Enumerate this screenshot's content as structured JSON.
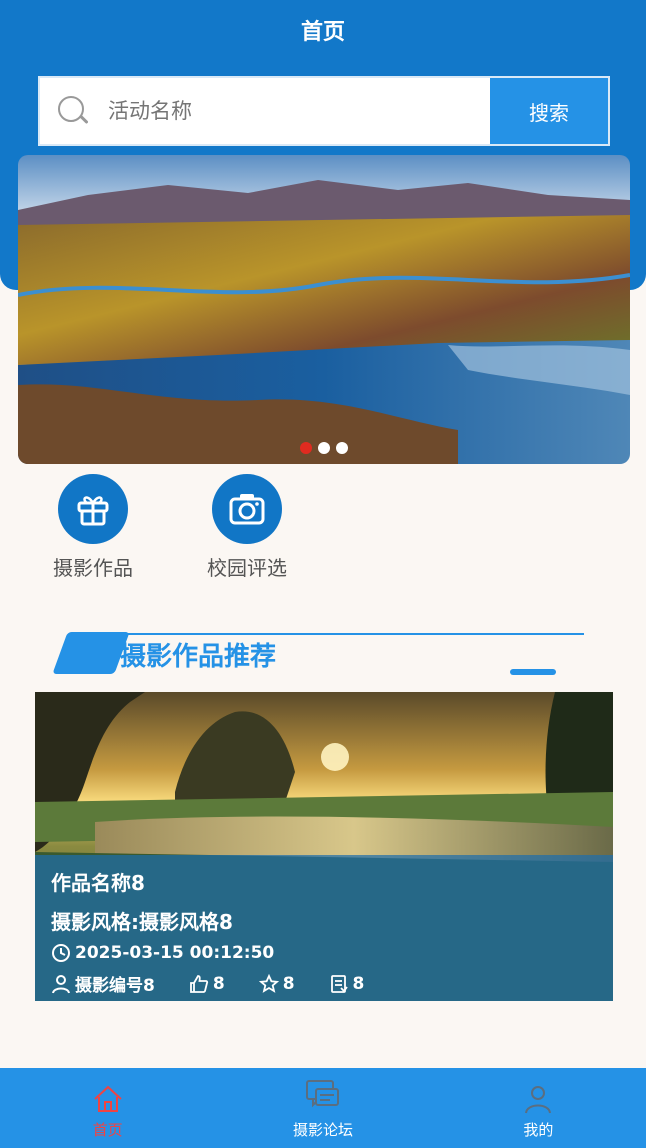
{
  "header": {
    "title": "首页"
  },
  "search": {
    "placeholder": "活动名称",
    "button_label": "搜索"
  },
  "banner": {
    "dots": 3,
    "active_dot": 0
  },
  "categories": [
    {
      "label": "摄影作品",
      "icon": "gift-icon"
    },
    {
      "label": "校园评选",
      "icon": "camera-icon"
    }
  ],
  "section": {
    "title": "摄影作品推荐"
  },
  "card": {
    "name": "作品名称8",
    "style": "摄影风格:摄影风格8",
    "time": "2025-03-15 00:12:50",
    "author": "摄影编号8",
    "likes": "8",
    "favorites": "8",
    "views": "8"
  },
  "tabbar": {
    "items": [
      {
        "label": "首页",
        "icon": "home-icon",
        "active": true
      },
      {
        "label": "摄影论坛",
        "icon": "chat-icon",
        "active": false
      },
      {
        "label": "我的",
        "icon": "user-icon",
        "active": false
      }
    ]
  },
  "colors": {
    "primary": "#1278c9",
    "accent": "#2592e6",
    "active_tab": "#e44444"
  }
}
